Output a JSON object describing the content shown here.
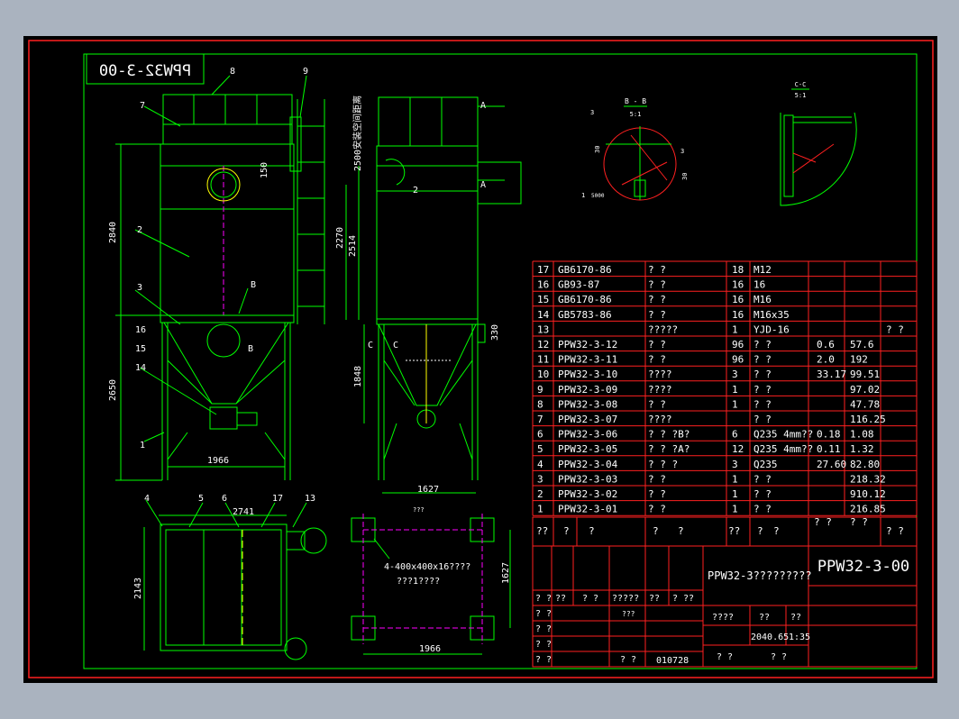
{
  "drawing_number": "PPW32-3-00",
  "drawing_number_mirrored": "PPW32-3-00",
  "view_labels": {
    "bb": "B - B",
    "bb_scale": "5:1",
    "cc": "C-C",
    "cc_scale": "5:1"
  },
  "front_dims": [
    "2840",
    "2650",
    "1966",
    "150",
    "2270",
    "2514",
    "2500"
  ],
  "side_dims": [
    "1848",
    "330",
    "1627"
  ],
  "plan_dims": [
    "2741",
    "2143"
  ],
  "base_dims": [
    "1627",
    "1966",
    "???"
  ],
  "base_note": [
    "4-400x400x16????",
    "???1????"
  ],
  "vertical_note": "2500安装空间距离",
  "front_callouts": [
    "8",
    "9",
    "7",
    "2",
    "3",
    "16",
    "15",
    "14",
    "1",
    "B",
    "B"
  ],
  "side_callouts": [
    "A",
    "A",
    "2",
    "C",
    "C"
  ],
  "plan_callouts": [
    "4",
    "5",
    "6",
    "17",
    "13"
  ],
  "detail_numbers": [
    "3",
    "30",
    "3",
    "30",
    "1",
    "5000"
  ],
  "bom_rows": [
    [
      "17",
      "GB6170-86",
      "?  ?",
      "18",
      "M12",
      "",
      "",
      ""
    ],
    [
      "16",
      "GB93-87",
      "?  ?",
      "16",
      "16",
      "",
      "",
      ""
    ],
    [
      "15",
      "GB6170-86",
      "?  ?",
      "16",
      "M16",
      "",
      "",
      ""
    ],
    [
      "14",
      "GB5783-86",
      "?  ?",
      "16",
      "M16x35",
      "",
      "",
      ""
    ],
    [
      "13",
      "",
      "?????",
      "1",
      "YJD-16",
      "",
      "",
      "?  ?"
    ],
    [
      "12",
      "PPW32-3-12",
      "?  ?",
      "96",
      "? ?",
      "0.6",
      "57.6",
      ""
    ],
    [
      "11",
      "PPW32-3-11",
      "?  ?",
      "96",
      "? ?",
      "2.0",
      "192",
      ""
    ],
    [
      "10",
      "PPW32-3-10",
      "????",
      "3",
      "? ?",
      "33.17",
      "99.51",
      ""
    ],
    [
      "9",
      "PPW32-3-09",
      "????",
      "1",
      "? ?",
      "",
      "97.02",
      ""
    ],
    [
      "8",
      "PPW32-3-08",
      "?  ?",
      "1",
      "? ?",
      "",
      "47.78",
      ""
    ],
    [
      "7",
      "PPW32-3-07",
      "????",
      "",
      "? ?",
      "",
      "116.25",
      ""
    ],
    [
      "6",
      "PPW32-3-06",
      "?  ? ?B?",
      "6",
      "Q235 4mm??",
      "0.18",
      "1.08",
      ""
    ],
    [
      "5",
      "PPW32-3-05",
      "?  ? ?A?",
      "12",
      "Q235 4mm??",
      "0.11",
      "1.32",
      ""
    ],
    [
      "4",
      "PPW32-3-04",
      "? ? ?",
      "3",
      "Q235",
      "27.60",
      "82.80",
      ""
    ],
    [
      "3",
      "PPW32-3-03",
      "?  ?",
      "1",
      "? ?",
      "",
      "218.32",
      ""
    ],
    [
      "2",
      "PPW32-3-02",
      "?  ?",
      "1",
      "? ?",
      "",
      "910.12",
      ""
    ],
    [
      "1",
      "PPW32-3-01",
      "?  ?",
      "1",
      "? ?",
      "",
      "216.85",
      ""
    ]
  ],
  "bom_header": [
    "??",
    "?",
    "?",
    "?",
    "?",
    "??",
    "?",
    "?",
    "? ?",
    "? ?",
    "? ?",
    "? ?"
  ],
  "title_block": {
    "product_name": "PPW32-3?????????",
    "number": "PPW32-3-00",
    "sign_row": [
      "? ?",
      "??",
      "? ?",
      "?????",
      "??",
      "? ??"
    ],
    "left_rows": [
      "? ?",
      "? ?",
      "? ?",
      "? ?"
    ],
    "stage_labels": [
      "????",
      "??",
      "??"
    ],
    "weight": "2040.65",
    "scale": "1:35",
    "date": "010728",
    "sheet": [
      "?  ?",
      "?  ?"
    ],
    "misc": [
      "???",
      "? ?",
      "? ?"
    ]
  },
  "colors": {
    "background": "#000000",
    "outer": "#aab3bf",
    "frame_red": "#ff2020",
    "line_green": "#00ff00",
    "text_white": "#ffffff",
    "cyan": "#00ffff",
    "yellow": "#ffff00",
    "magenta": "#ff00ff",
    "red_hatch": "#ff2020"
  }
}
